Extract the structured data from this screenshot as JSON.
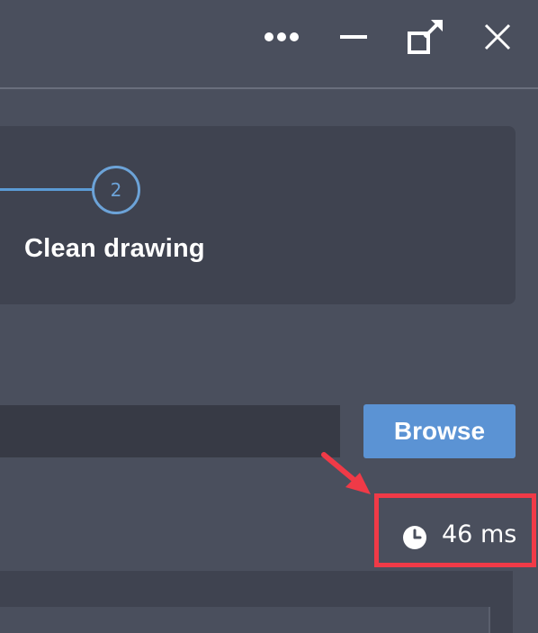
{
  "window": {
    "controls": {
      "more": "more-options",
      "minimize": "minimize",
      "popout": "pop-out",
      "close": "close"
    }
  },
  "steps": {
    "current_number": "2",
    "current_label": "Clean drawing"
  },
  "file": {
    "path_value": "",
    "browse_label": "Browse"
  },
  "timing": {
    "value": "46 ms"
  },
  "colors": {
    "accent": "#5b93d4",
    "highlight": "#f03a47",
    "background": "#4a4f5d",
    "panel": "#3f4350"
  }
}
